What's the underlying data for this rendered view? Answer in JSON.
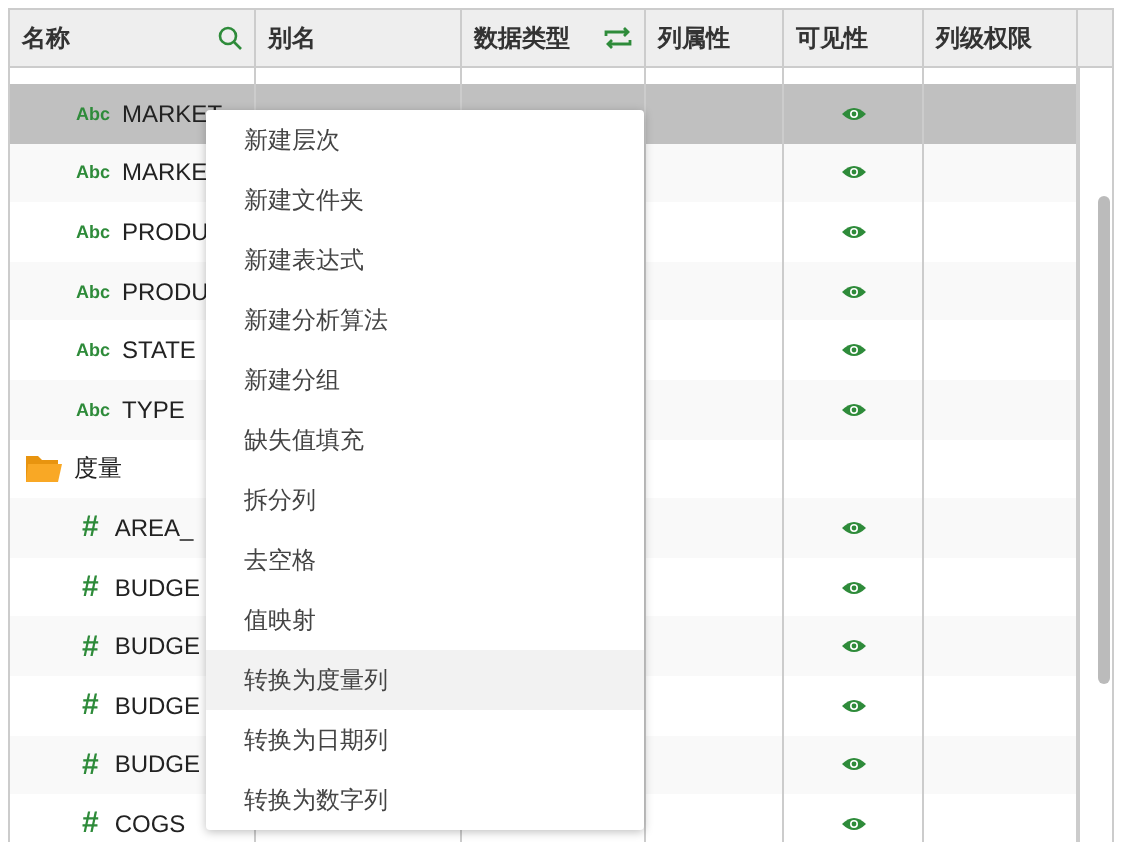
{
  "table": {
    "columns": [
      {
        "label": "名称",
        "kind": "search"
      },
      {
        "label": "别名"
      },
      {
        "label": "数据类型",
        "kind": "swap"
      },
      {
        "label": "列属性"
      },
      {
        "label": "可见性"
      },
      {
        "label": "列级权限"
      }
    ],
    "rows": [
      {
        "kind": "dimension",
        "type_mark": "Abc",
        "name": "MARKET",
        "visible": true,
        "selected": true
      },
      {
        "kind": "dimension",
        "type_mark": "Abc",
        "name": "MARKE",
        "visible": true,
        "selected": false
      },
      {
        "kind": "dimension",
        "type_mark": "Abc",
        "name": "PRODU",
        "visible": true,
        "selected": false
      },
      {
        "kind": "dimension",
        "type_mark": "Abc",
        "name": "PRODU",
        "visible": true,
        "selected": false
      },
      {
        "kind": "dimension",
        "type_mark": "Abc",
        "name": "STATE",
        "visible": true,
        "selected": false
      },
      {
        "kind": "dimension",
        "type_mark": "Abc",
        "name": "TYPE",
        "visible": true,
        "selected": false
      },
      {
        "kind": "folder",
        "name": "度量",
        "visible": false,
        "selected": false
      },
      {
        "kind": "measure",
        "type_mark": "#",
        "name": "AREA_",
        "visible": true,
        "selected": false
      },
      {
        "kind": "measure",
        "type_mark": "#",
        "name": "BUDGE",
        "visible": true,
        "selected": false
      },
      {
        "kind": "measure",
        "type_mark": "#",
        "name": "BUDGE",
        "visible": true,
        "selected": false
      },
      {
        "kind": "measure",
        "type_mark": "#",
        "name": "BUDGE",
        "visible": true,
        "selected": false
      },
      {
        "kind": "measure",
        "type_mark": "#",
        "name": "BUDGE",
        "visible": true,
        "selected": false
      },
      {
        "kind": "measure",
        "type_mark": "#",
        "name": "COGS",
        "visible": true,
        "selected": false
      }
    ]
  },
  "context_menu": [
    {
      "label": "新建层次",
      "selected": false
    },
    {
      "label": "新建文件夹",
      "selected": false
    },
    {
      "label": "新建表达式",
      "selected": false
    },
    {
      "label": "新建分析算法",
      "selected": false
    },
    {
      "label": "新建分组",
      "selected": false
    },
    {
      "label": "缺失值填充",
      "selected": false
    },
    {
      "label": "拆分列",
      "selected": false
    },
    {
      "label": "去空格",
      "selected": false
    },
    {
      "label": "值映射",
      "selected": false
    },
    {
      "label": "转换为度量列",
      "selected": true
    },
    {
      "label": "转换为日期列",
      "selected": false
    },
    {
      "label": "转换为数字列",
      "selected": false
    }
  ]
}
